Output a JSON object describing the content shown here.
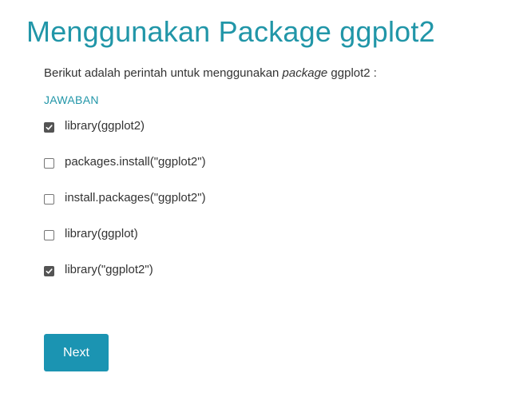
{
  "title": "Menggunakan Package ggplot2",
  "question": {
    "prefix": "Berikut adalah perintah untuk menggunakan ",
    "emphasis": "package",
    "suffix": " ggplot2 :"
  },
  "answer_label": "JAWABAN",
  "options": [
    {
      "label": "library(ggplot2)",
      "checked": true
    },
    {
      "label": "packages.install(\"ggplot2\")",
      "checked": false
    },
    {
      "label": "install.packages(\"ggplot2\")",
      "checked": false
    },
    {
      "label": "library(ggplot)",
      "checked": false
    },
    {
      "label": "library(\"ggplot2\")",
      "checked": true
    }
  ],
  "next_button": {
    "label": "Next"
  },
  "colors": {
    "accent": "#2196a8",
    "button": "#1b94b2",
    "text": "#333333",
    "checkbox_checked": "#545454"
  }
}
